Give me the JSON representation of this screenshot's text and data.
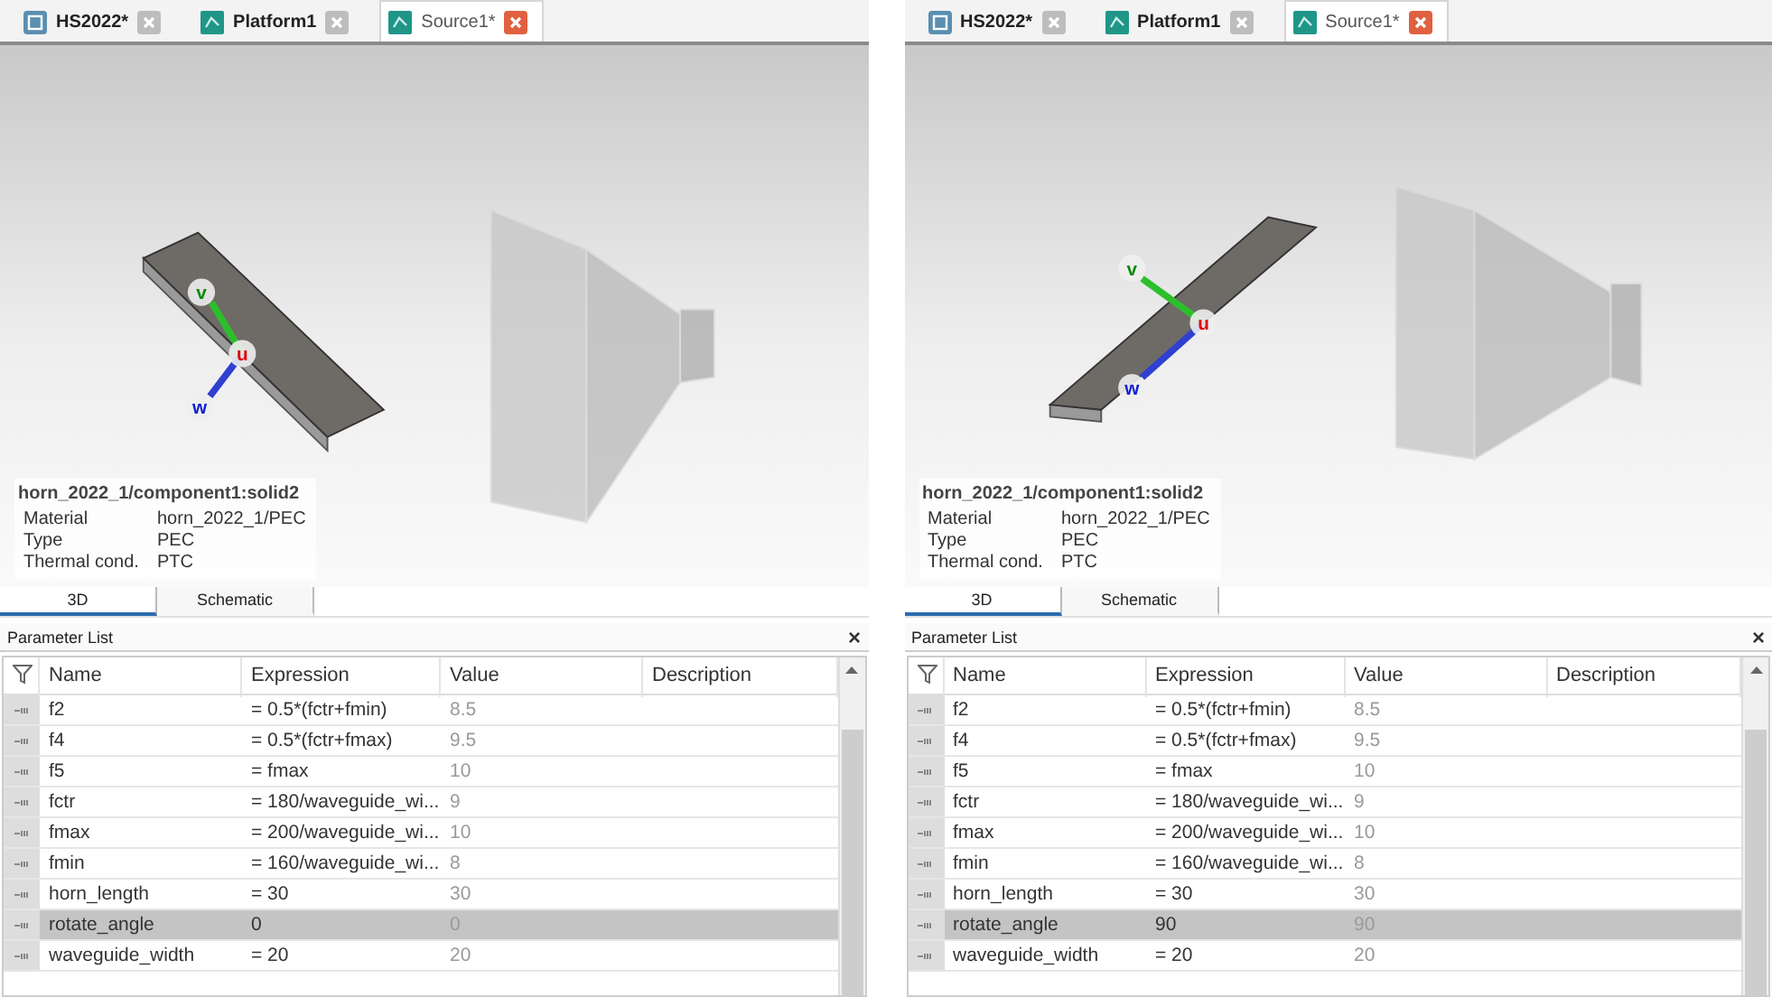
{
  "panels": [
    {
      "tabs": [
        {
          "label": "HS2022*",
          "kind": "assembly",
          "selected": false
        },
        {
          "label": "Platform1",
          "kind": "part",
          "selected": false
        },
        {
          "label": "Source1*",
          "kind": "part",
          "selected": true
        }
      ],
      "object_info": {
        "title": "horn_2022_1/component1:solid2",
        "properties": [
          {
            "label": "Material",
            "value": "horn_2022_1/PEC"
          },
          {
            "label": "Type",
            "value": "PEC"
          },
          {
            "label": "Thermal cond.",
            "value": "PTC"
          }
        ]
      },
      "axes": [
        "u",
        "v",
        "w"
      ],
      "view_tabs": [
        {
          "label": "3D",
          "selected": true
        },
        {
          "label": "Schematic",
          "selected": false
        }
      ],
      "parameter_list": {
        "title": "Parameter List",
        "close": "×",
        "columns": [
          "Name",
          "Expression",
          "Value",
          "Description"
        ],
        "rows": [
          {
            "name": "f2",
            "expression": "= 0.5*(fctr+fmin)",
            "value": "8.5",
            "selected": false
          },
          {
            "name": "f4",
            "expression": "= 0.5*(fctr+fmax)",
            "value": "9.5",
            "selected": false
          },
          {
            "name": "f5",
            "expression": "= fmax",
            "value": "10",
            "selected": false
          },
          {
            "name": "fctr",
            "expression": "= 180/waveguide_wi...",
            "value": "9",
            "selected": false
          },
          {
            "name": "fmax",
            "expression": "= 200/waveguide_wi...",
            "value": "10",
            "selected": false
          },
          {
            "name": "fmin",
            "expression": "= 160/waveguide_wi...",
            "value": "8",
            "selected": false
          },
          {
            "name": "horn_length",
            "expression": "= 30",
            "value": "30",
            "selected": false
          },
          {
            "name": "rotate_angle",
            "expression": "0",
            "value": "0",
            "selected": true
          },
          {
            "name": "waveguide_width",
            "expression": "= 20",
            "value": "20",
            "selected": false
          }
        ]
      }
    },
    {
      "tabs": [
        {
          "label": "HS2022*",
          "kind": "assembly",
          "selected": false
        },
        {
          "label": "Platform1",
          "kind": "part",
          "selected": false
        },
        {
          "label": "Source1*",
          "kind": "part",
          "selected": true
        }
      ],
      "object_info": {
        "title": "horn_2022_1/component1:solid2",
        "properties": [
          {
            "label": "Material",
            "value": "horn_2022_1/PEC"
          },
          {
            "label": "Type",
            "value": "PEC"
          },
          {
            "label": "Thermal cond.",
            "value": "PTC"
          }
        ]
      },
      "axes": [
        "u",
        "v",
        "w"
      ],
      "view_tabs": [
        {
          "label": "3D",
          "selected": true
        },
        {
          "label": "Schematic",
          "selected": false
        }
      ],
      "parameter_list": {
        "title": "Parameter List",
        "close": "×",
        "columns": [
          "Name",
          "Expression",
          "Value",
          "Description"
        ],
        "rows": [
          {
            "name": "f2",
            "expression": "= 0.5*(fctr+fmin)",
            "value": "8.5",
            "selected": false
          },
          {
            "name": "f4",
            "expression": "= 0.5*(fctr+fmax)",
            "value": "9.5",
            "selected": false
          },
          {
            "name": "f5",
            "expression": "= fmax",
            "value": "10",
            "selected": false
          },
          {
            "name": "fctr",
            "expression": "= 180/waveguide_wi...",
            "value": "9",
            "selected": false
          },
          {
            "name": "fmax",
            "expression": "= 200/waveguide_wi...",
            "value": "10",
            "selected": false
          },
          {
            "name": "fmin",
            "expression": "= 160/waveguide_wi...",
            "value": "8",
            "selected": false
          },
          {
            "name": "horn_length",
            "expression": "= 30",
            "value": "30",
            "selected": false
          },
          {
            "name": "rotate_angle",
            "expression": "90",
            "value": "90",
            "selected": true
          },
          {
            "name": "waveguide_width",
            "expression": "= 20",
            "value": "20",
            "selected": false
          }
        ]
      }
    }
  ]
}
